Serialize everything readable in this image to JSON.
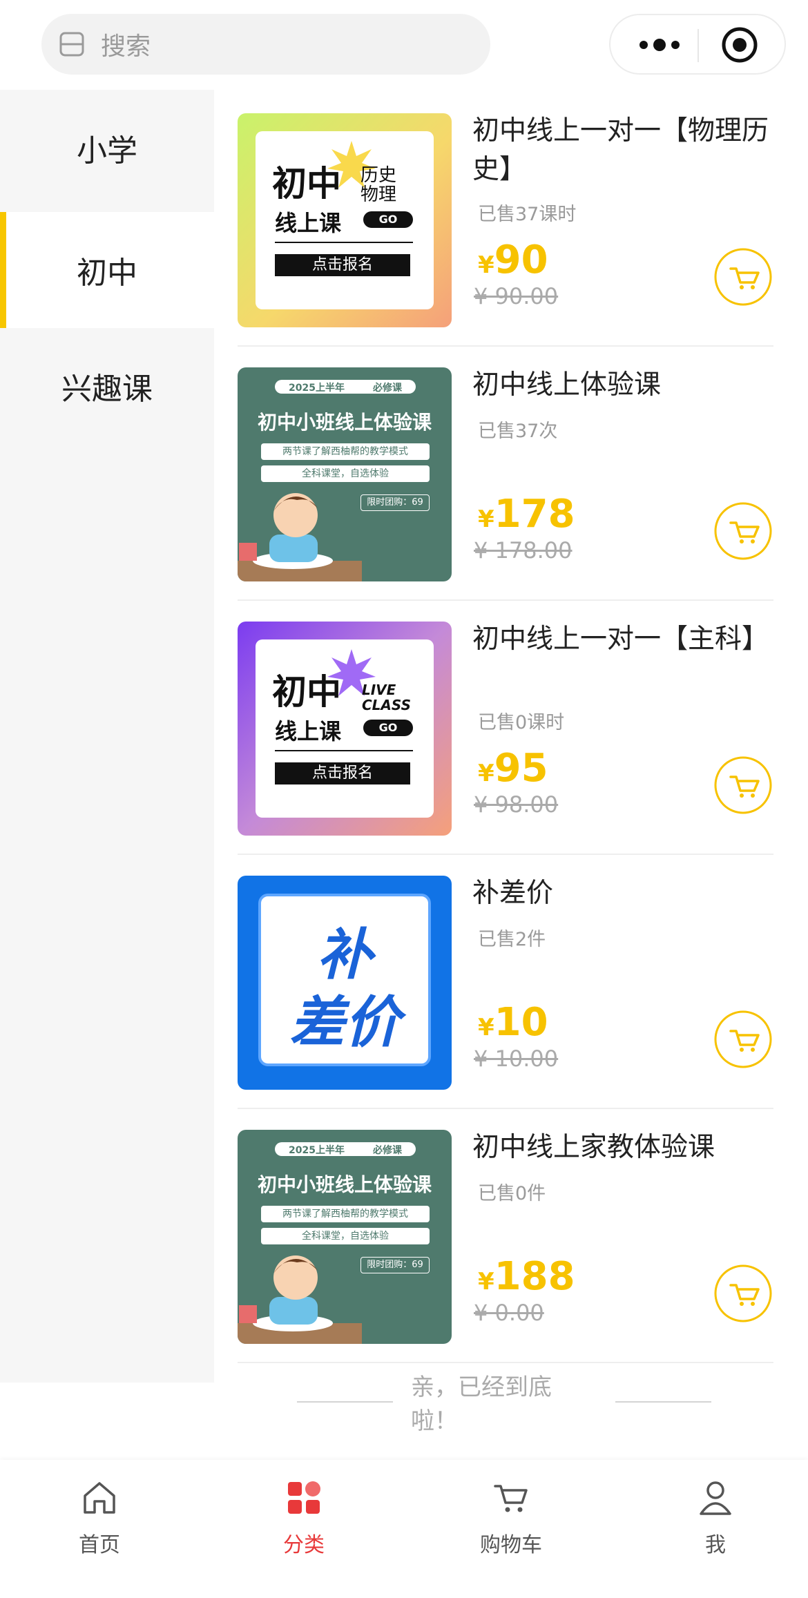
{
  "search": {
    "placeholder": "搜索",
    "icon": "scan-icon"
  },
  "capsule": {
    "more_icon": "more-dots-icon",
    "close_icon": "target-icon"
  },
  "sidebar": {
    "items": [
      {
        "label": "小学"
      },
      {
        "label": "初中",
        "active": true
      },
      {
        "label": "兴趣课"
      }
    ]
  },
  "products": [
    {
      "name": "初中线上一对一【物理历史】",
      "sold": "已售37课时",
      "currency": "¥",
      "price": "90",
      "original_price": "¥ 90.00",
      "thumb": {
        "big": [
          "初中",
          "线上课"
        ],
        "side": [
          "历史",
          "物理"
        ],
        "go": "GO",
        "cta": "点击报名"
      }
    },
    {
      "name": "初中线上体验课",
      "sold": "已售37次",
      "currency": "¥",
      "price": "178",
      "original_price": "¥ 178.00",
      "thumb": {
        "tag1": "2025上半年",
        "tag2": "必修课",
        "title": "初中小班线上体验课",
        "line1": "两节课了解西柚帮的教学模式",
        "line2": "全科课堂，自选体验",
        "promo": "限时团购：69"
      }
    },
    {
      "name": "初中线上一对一【主科】",
      "sold": "已售0课时",
      "currency": "¥",
      "price": "95",
      "original_price": "¥ 98.00",
      "thumb": {
        "big": [
          "初中",
          "线上课"
        ],
        "side": [
          "LIVE",
          "CLASS"
        ],
        "go": "GO",
        "cta": "点击报名"
      }
    },
    {
      "name": "补差价",
      "sold": "已售2件",
      "currency": "¥",
      "price": "10",
      "original_price": "¥ 10.00",
      "thumb": {
        "text": [
          "补",
          "差价"
        ]
      }
    },
    {
      "name": "初中线上家教体验课",
      "sold": "已售0件",
      "currency": "¥",
      "price": "188",
      "original_price": "¥ 0.00",
      "thumb": {
        "tag1": "2025上半年",
        "tag2": "必修课",
        "title": "初中小班线上体验课",
        "line1": "两节课了解西柚帮的教学模式",
        "line2": "全科课堂，自选体验",
        "promo": "限时团购：69"
      }
    }
  ],
  "end_text": "亲，已经到底啦！",
  "tabbar": {
    "items": [
      {
        "label": "首页",
        "icon": "home-icon"
      },
      {
        "label": "分类",
        "icon": "category-icon",
        "active": true
      },
      {
        "label": "购物车",
        "icon": "cart-icon"
      },
      {
        "label": "我",
        "icon": "user-icon"
      }
    ]
  },
  "colors": {
    "accent": "#f7c200",
    "active_tab": "#e8393a",
    "sidebar_bg": "#f6f6f6",
    "sidebar_indicator": "#f7c600"
  }
}
